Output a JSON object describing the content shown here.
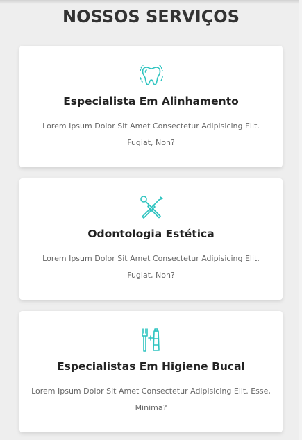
{
  "section": {
    "title": "NOSSOS SERVIÇOS"
  },
  "colors": {
    "accent": "#2ec4c0",
    "title": "#333333",
    "text": "#666666",
    "background": "#eeeeee",
    "card": "#ffffff"
  },
  "services": [
    {
      "icon": "tooth-icon",
      "title": "Especialista Em Alinhamento",
      "text": "Lorem Ipsum Dolor Sit Amet Consectetur Adipisicing Elit. Fugiat, Non?"
    },
    {
      "icon": "dental-tools-icon",
      "title": "Odontologia Estética",
      "text": "Lorem Ipsum Dolor Sit Amet Consectetur Adipisicing Elit. Fugiat, Non?"
    },
    {
      "icon": "toothbrush-toothpaste-icon",
      "title": "Especialistas Em Higiene Bucal",
      "text": "Lorem Ipsum Dolor Sit Amet Consectetur Adipisicing Elit. Esse, Minima?"
    }
  ]
}
